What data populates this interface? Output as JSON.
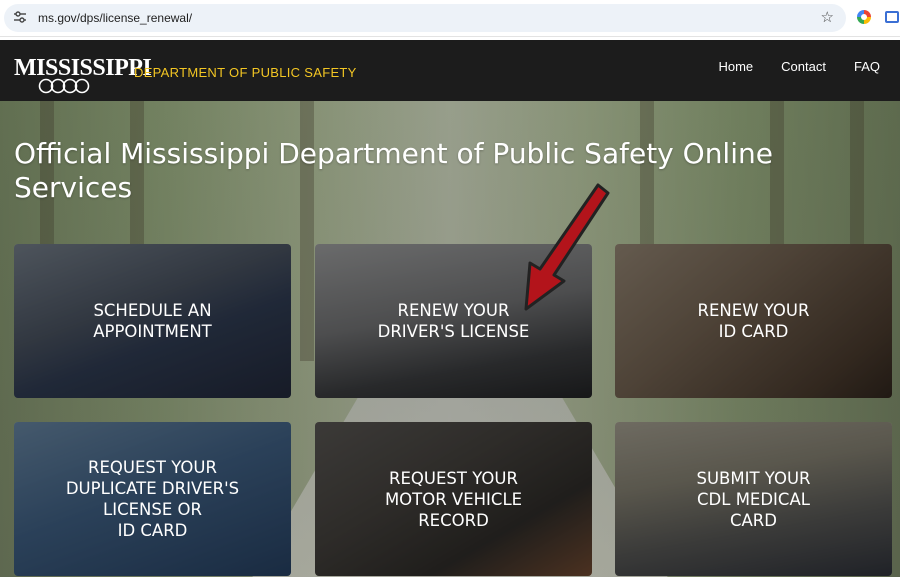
{
  "browser": {
    "url": "ms.gov/dps/license_renewal/",
    "icons": [
      "tune-icon",
      "star-icon",
      "extension-icon",
      "side-panel-icon"
    ]
  },
  "header": {
    "logo_text": "MISSISSIPPI",
    "department": "DEPARTMENT OF PUBLIC SAFETY",
    "nav": [
      "Home",
      "Contact",
      "FAQ"
    ],
    "accent_color": "#f3c623",
    "background_color": "#1c1c1c"
  },
  "hero": {
    "title": "Official Mississippi Department of Public Safety Online Services"
  },
  "tiles": [
    {
      "label": "SCHEDULE AN\nAPPOINTMENT"
    },
    {
      "label": "RENEW YOUR\nDRIVER'S LICENSE"
    },
    {
      "label": "RENEW YOUR\nID CARD"
    },
    {
      "label": "REQUEST YOUR\nDUPLICATE DRIVER'S\nLICENSE OR\nID CARD"
    },
    {
      "label": "REQUEST YOUR\nMOTOR VEHICLE\nRECORD"
    },
    {
      "label": "SUBMIT YOUR\nCDL MEDICAL\nCARD"
    }
  ],
  "annotation": {
    "arrow_color": "#b3141b",
    "points_to": "RENEW YOUR DRIVER'S LICENSE"
  }
}
